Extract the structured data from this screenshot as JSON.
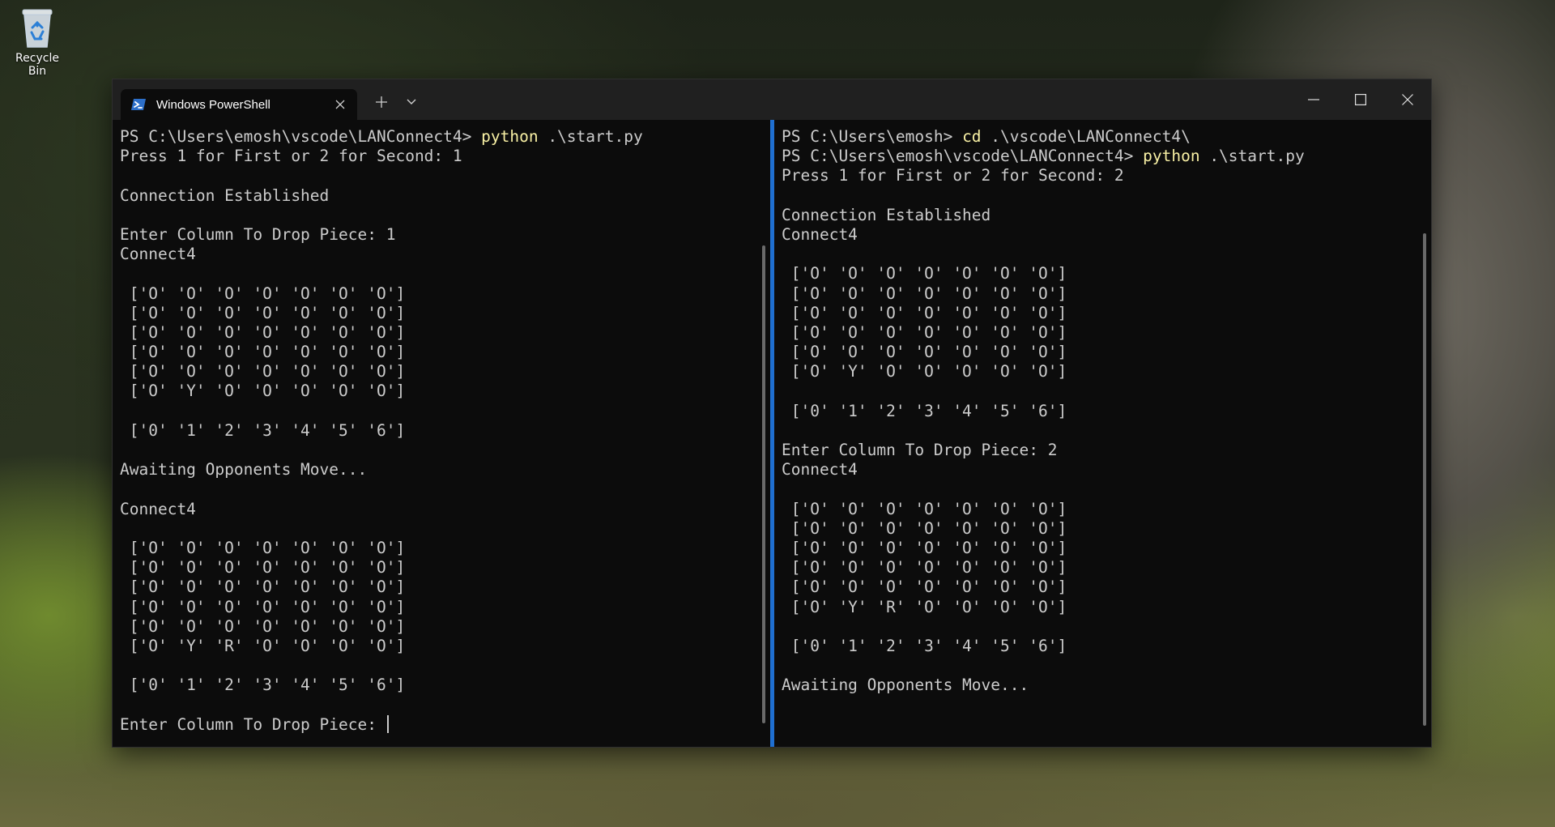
{
  "desktop": {
    "recycle_bin_label": "Recycle Bin"
  },
  "window": {
    "tab_title": "Windows PowerShell",
    "tab_icon": "powershell-icon",
    "new_tab_icon": "plus-icon",
    "dropdown_icon": "chevron-down-icon",
    "minimize_icon": "minimize-icon",
    "maximize_icon": "maximize-icon",
    "close_icon": "close-icon",
    "accent_color": "#1f6fd1",
    "command_color": "#f9f1a5"
  },
  "left_pane": {
    "lines": [
      {
        "prompt": "PS C:\\Users\\emosh\\vscode\\LANConnect4> ",
        "cmd": "python",
        "rest": " .\\start.py"
      },
      {
        "text": "Press 1 for First or 2 for Second: 1"
      },
      {
        "text": ""
      },
      {
        "text": "Connection Established"
      },
      {
        "text": ""
      },
      {
        "text": "Enter Column To Drop Piece: 1"
      },
      {
        "text": "Connect4"
      },
      {
        "text": ""
      },
      {
        "text": " ['O' 'O' 'O' 'O' 'O' 'O' 'O']"
      },
      {
        "text": " ['O' 'O' 'O' 'O' 'O' 'O' 'O']"
      },
      {
        "text": " ['O' 'O' 'O' 'O' 'O' 'O' 'O']"
      },
      {
        "text": " ['O' 'O' 'O' 'O' 'O' 'O' 'O']"
      },
      {
        "text": " ['O' 'O' 'O' 'O' 'O' 'O' 'O']"
      },
      {
        "text": " ['O' 'Y' 'O' 'O' 'O' 'O' 'O']"
      },
      {
        "text": ""
      },
      {
        "text": " ['0' '1' '2' '3' '4' '5' '6']"
      },
      {
        "text": ""
      },
      {
        "text": "Awaiting Opponents Move..."
      },
      {
        "text": ""
      },
      {
        "text": "Connect4"
      },
      {
        "text": ""
      },
      {
        "text": " ['O' 'O' 'O' 'O' 'O' 'O' 'O']"
      },
      {
        "text": " ['O' 'O' 'O' 'O' 'O' 'O' 'O']"
      },
      {
        "text": " ['O' 'O' 'O' 'O' 'O' 'O' 'O']"
      },
      {
        "text": " ['O' 'O' 'O' 'O' 'O' 'O' 'O']"
      },
      {
        "text": " ['O' 'O' 'O' 'O' 'O' 'O' 'O']"
      },
      {
        "text": " ['O' 'Y' 'R' 'O' 'O' 'O' 'O']"
      },
      {
        "text": ""
      },
      {
        "text": " ['0' '1' '2' '3' '4' '5' '6']"
      },
      {
        "text": ""
      },
      {
        "text": "Enter Column To Drop Piece: ",
        "cursor": true
      }
    ]
  },
  "right_pane": {
    "lines": [
      {
        "prompt": "PS C:\\Users\\emosh> ",
        "cmd": "cd",
        "rest": " .\\vscode\\LANConnect4\\"
      },
      {
        "prompt": "PS C:\\Users\\emosh\\vscode\\LANConnect4> ",
        "cmd": "python",
        "rest": " .\\start.py"
      },
      {
        "text": "Press 1 for First or 2 for Second: 2"
      },
      {
        "text": ""
      },
      {
        "text": "Connection Established"
      },
      {
        "text": "Connect4"
      },
      {
        "text": ""
      },
      {
        "text": " ['O' 'O' 'O' 'O' 'O' 'O' 'O']"
      },
      {
        "text": " ['O' 'O' 'O' 'O' 'O' 'O' 'O']"
      },
      {
        "text": " ['O' 'O' 'O' 'O' 'O' 'O' 'O']"
      },
      {
        "text": " ['O' 'O' 'O' 'O' 'O' 'O' 'O']"
      },
      {
        "text": " ['O' 'O' 'O' 'O' 'O' 'O' 'O']"
      },
      {
        "text": " ['O' 'Y' 'O' 'O' 'O' 'O' 'O']"
      },
      {
        "text": ""
      },
      {
        "text": " ['0' '1' '2' '3' '4' '5' '6']"
      },
      {
        "text": ""
      },
      {
        "text": "Enter Column To Drop Piece: 2"
      },
      {
        "text": "Connect4"
      },
      {
        "text": ""
      },
      {
        "text": " ['O' 'O' 'O' 'O' 'O' 'O' 'O']"
      },
      {
        "text": " ['O' 'O' 'O' 'O' 'O' 'O' 'O']"
      },
      {
        "text": " ['O' 'O' 'O' 'O' 'O' 'O' 'O']"
      },
      {
        "text": " ['O' 'O' 'O' 'O' 'O' 'O' 'O']"
      },
      {
        "text": " ['O' 'O' 'O' 'O' 'O' 'O' 'O']"
      },
      {
        "text": " ['O' 'Y' 'R' 'O' 'O' 'O' 'O']"
      },
      {
        "text": ""
      },
      {
        "text": " ['0' '1' '2' '3' '4' '5' '6']"
      },
      {
        "text": ""
      },
      {
        "text": "Awaiting Opponents Move..."
      }
    ]
  }
}
